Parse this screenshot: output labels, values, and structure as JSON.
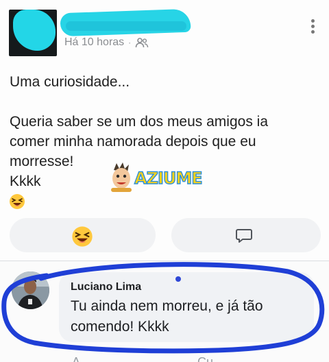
{
  "post": {
    "timestamp": "Há 10 horas",
    "separator": "·",
    "privacy_icon": "friends-icon",
    "text_line1": "Uma curiosidade...",
    "text_line2": "Queria saber se um dos meus amigos ia",
    "text_line3": "comer minha namorada depois que eu",
    "text_line4": "morresse!",
    "text_line5": "Kkkk",
    "emoji": "laughing-emoji"
  },
  "actions": {
    "react_icon": "laughing-emoji",
    "comment_icon": "comment-icon"
  },
  "watermark": {
    "text": "AZIUME"
  },
  "comment": {
    "author": "Luciano Lima",
    "text_line1": "Tu ainda nem morreu, e já tão",
    "text_line2": "comendo! Kkkk"
  },
  "colors": {
    "scribble": "#27d4e6",
    "annotation": "#1f3fd6",
    "emoji": "#ffc83d"
  }
}
